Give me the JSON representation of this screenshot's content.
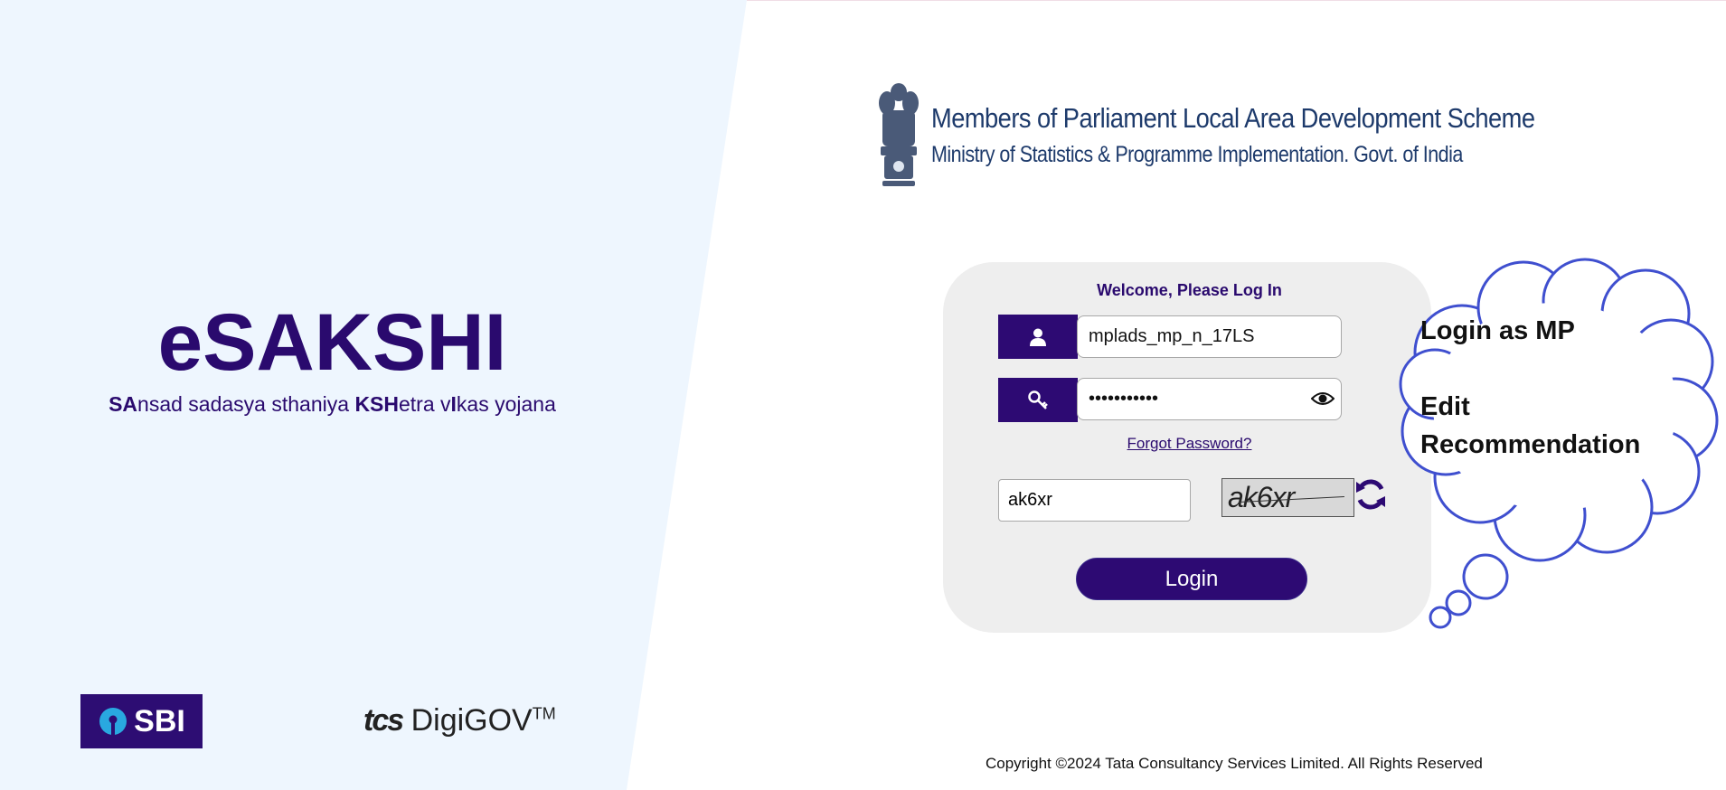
{
  "brand": {
    "title": "eSAKSHI",
    "subtitle_parts": [
      "SA",
      "nsad sadasya sthaniya ",
      "KSH",
      "etra v",
      "I",
      "kas yojana"
    ]
  },
  "header": {
    "title": "Members of Parliament Local Area Development Scheme",
    "subtitle": "Ministry of Statistics & Programme Implementation. Govt. of India"
  },
  "login": {
    "welcome": "Welcome, Please Log In",
    "username_value": "mplads_mp_n_17LS",
    "password_value": "•••••••••••",
    "forgot_label": "Forgot Password?",
    "captcha_value": "ak6xr",
    "captcha_image_text": "ak6xr",
    "login_label": "Login"
  },
  "annotation": {
    "line1": "Login as MP",
    "line2": "Edit",
    "line3": "Recommendation"
  },
  "partners": {
    "sbi": "SBI",
    "tcs_prefix": "tcs",
    "tcs_name": "DigiGOV",
    "tcs_mark": "TM"
  },
  "footer": {
    "copyright": "Copyright ©2024 Tata Consultancy Services Limited. All Rights Reserved"
  },
  "colors": {
    "primary": "#2d0a73",
    "left_panel": "#eef6fe",
    "card": "#eeeeee",
    "cloud_stroke": "#3f4fcf"
  },
  "icons": [
    "user-icon",
    "key-icon",
    "eye-icon",
    "refresh-icon",
    "emblem-icon",
    "sbi-keyhole-icon"
  ]
}
